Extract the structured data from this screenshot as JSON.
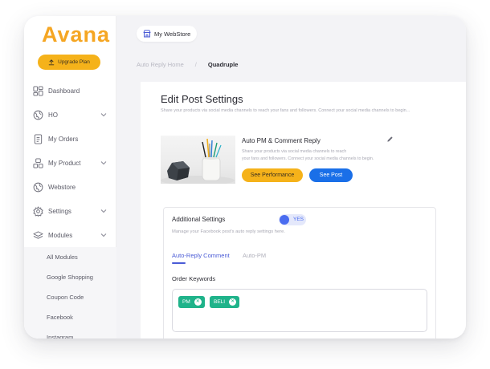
{
  "app": {
    "logo": "Avana",
    "brand_color": "#f5a623",
    "primary_color": "#1a6fe8",
    "accent_color": "#4a5bd6",
    "chip_color": "#1fb38a"
  },
  "sidebar": {
    "upgrade_label": "Upgrade Plan",
    "items": [
      {
        "label": "Dashboard",
        "icon": "dashboard-icon"
      },
      {
        "label": "HO",
        "icon": "globe-icon",
        "expandable": true
      },
      {
        "label": "My Orders",
        "icon": "orders-icon"
      },
      {
        "label": "My Product",
        "icon": "product-icon",
        "expandable": true
      },
      {
        "label": "Webstore",
        "icon": "globe-icon"
      },
      {
        "label": "Settings",
        "icon": "gear-icon",
        "expandable": true
      },
      {
        "label": "Modules",
        "icon": "layers-icon",
        "expandable": true
      }
    ],
    "module_items": [
      "All Modules",
      "Google Shopping",
      "Coupon Code",
      "Facebook",
      "Instagram"
    ]
  },
  "header": {
    "store_name": "My WebStore"
  },
  "breadcrumb": {
    "parent": "Auto Reply Home",
    "separator": "/",
    "current": "Quadruple"
  },
  "page": {
    "title": "Edit Post Settings",
    "subtitle": "Share your products via social media channels to reach your fans and followers. Connect your social media channels to begin..."
  },
  "post": {
    "title": "Auto PM & Comment Reply",
    "description_line1": "Share your products via social media channels to reach",
    "description_line2": "your fans and followers. Connect your social media channels to begin.",
    "performance_button": "See Performance",
    "post_button": "See Post"
  },
  "additional_settings": {
    "title": "Additional Settings",
    "toggle_label": "YES",
    "toggle_on": true,
    "subtitle": "Manage your Facebook post's auto reply settings here.",
    "tabs": [
      {
        "label": "Auto-Reply Comment",
        "active": true
      },
      {
        "label": "Auto-PM",
        "active": false
      }
    ],
    "keywords_label": "Order Keywords",
    "keywords": [
      "PM",
      "BELI"
    ]
  }
}
